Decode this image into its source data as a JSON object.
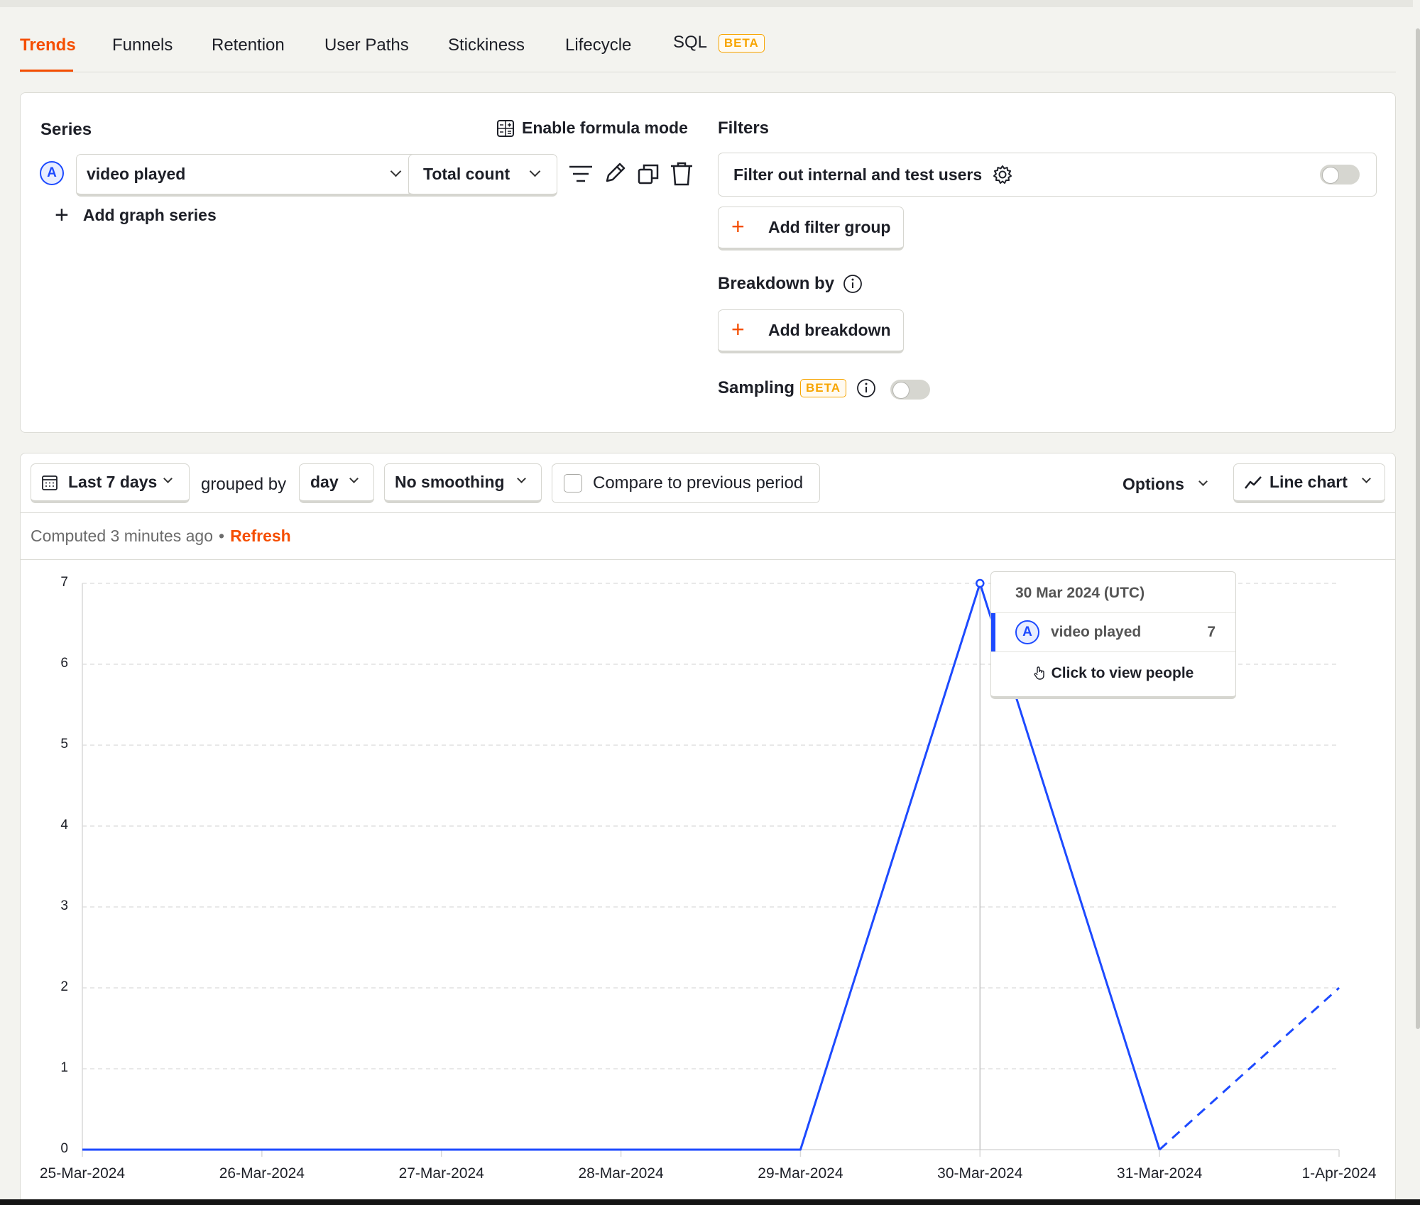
{
  "tabs": [
    {
      "label": "Trends",
      "active": true
    },
    {
      "label": "Funnels"
    },
    {
      "label": "Retention"
    },
    {
      "label": "User Paths"
    },
    {
      "label": "Stickiness"
    },
    {
      "label": "Lifecycle"
    },
    {
      "label": "SQL",
      "badge": "BETA"
    }
  ],
  "series": {
    "heading": "Series",
    "formula_mode": "Enable formula mode",
    "item": {
      "letter": "A",
      "event": "video played",
      "aggregation": "Total count"
    },
    "add_series": "Add graph series"
  },
  "filters": {
    "heading": "Filters",
    "internal_users": "Filter out internal and test users",
    "add_filter_group": "Add filter group",
    "breakdown_heading": "Breakdown by",
    "add_breakdown": "Add breakdown",
    "sampling": "Sampling",
    "sampling_badge": "BETA"
  },
  "toolbar": {
    "date_range": "Last 7 days",
    "grouped_by_label": "grouped by",
    "interval": "day",
    "smoothing": "No smoothing",
    "compare": "Compare to previous period",
    "options": "Options",
    "chart_type": "Line chart"
  },
  "status": {
    "computed": "Computed 3 minutes ago",
    "separator": "•",
    "refresh": "Refresh"
  },
  "tooltip": {
    "date": "30 Mar 2024 (UTC)",
    "letter": "A",
    "series": "video played",
    "value": "7",
    "action": "Click to view people"
  },
  "colors": {
    "accent": "#f54e00",
    "series": "#1d4aff",
    "beta": "#f7a501"
  },
  "chart_data": {
    "type": "line",
    "categories": [
      "25-Mar-2024",
      "26-Mar-2024",
      "27-Mar-2024",
      "28-Mar-2024",
      "29-Mar-2024",
      "30-Mar-2024",
      "31-Mar-2024",
      "1-Apr-2024"
    ],
    "series": [
      {
        "name": "video played",
        "values": [
          0,
          0,
          0,
          0,
          0,
          7,
          0,
          2
        ],
        "incomplete_from_index": 6
      }
    ],
    "yticks": [
      0,
      1,
      2,
      3,
      4,
      5,
      6,
      7
    ],
    "ylim": [
      0,
      7
    ],
    "grid": true,
    "legend": "none"
  }
}
